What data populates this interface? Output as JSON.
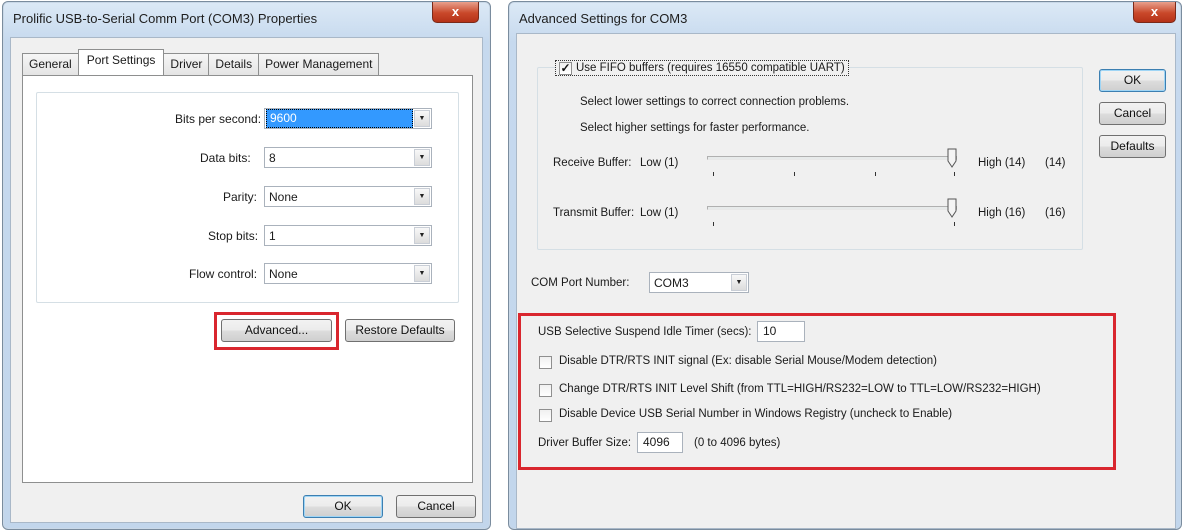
{
  "left_dialog": {
    "title": "Prolific USB-to-Serial Comm Port (COM3) Properties",
    "close_label": "x",
    "tabs": [
      "General",
      "Port Settings",
      "Driver",
      "Details",
      "Power Management"
    ],
    "active_tab": "Port Settings",
    "fields": {
      "bits_per_second": {
        "label": "Bits per second:",
        "value": "9600"
      },
      "data_bits": {
        "label": "Data bits:",
        "value": "8"
      },
      "parity": {
        "label": "Parity:",
        "value": "None"
      },
      "stop_bits": {
        "label": "Stop bits:",
        "value": "1"
      },
      "flow_control": {
        "label": "Flow control:",
        "value": "None"
      }
    },
    "advanced_label": "Advanced...",
    "restore_defaults_label": "Restore Defaults",
    "ok_label": "OK",
    "cancel_label": "Cancel"
  },
  "right_dialog": {
    "title": "Advanced Settings for COM3",
    "close_label": "x",
    "fifo_label": "Use FIFO buffers (requires 16550 compatible UART)",
    "fifo_checked": true,
    "hint_lower": "Select lower settings to correct connection problems.",
    "hint_higher": "Select higher settings for faster performance.",
    "receive_buffer": {
      "label": "Receive Buffer:",
      "low": "Low (1)",
      "high": "High (14)",
      "value_text": "(14)",
      "level": 1.0
    },
    "transmit_buffer": {
      "label": "Transmit Buffer:",
      "low": "Low (1)",
      "high": "High (16)",
      "value_text": "(16)",
      "level": 1.0
    },
    "com_port_label": "COM Port Number:",
    "com_port_value": "COM3",
    "ok_label": "OK",
    "cancel_label": "Cancel",
    "defaults_label": "Defaults",
    "usb_suspend_label": "USB Selective Suspend Idle Timer (secs):",
    "usb_suspend_value": "10",
    "disable_dtr_label": "Disable DTR/RTS INIT signal (Ex: disable Serial Mouse/Modem detection)",
    "change_dtr_label": "Change DTR/RTS INIT Level Shift (from TTL=HIGH/RS232=LOW to TTL=LOW/RS232=HIGH)",
    "disable_serial_label": "Disable Device USB Serial Number in Windows Registry (uncheck to Enable)",
    "driver_buffer_label": "Driver Buffer Size:",
    "driver_buffer_value": "4096",
    "driver_buffer_range": "(0 to 4096 bytes)"
  },
  "colors": {
    "highlight_box": "#d9262e",
    "selection": "#3399ff",
    "close_button": "#c9482a"
  }
}
